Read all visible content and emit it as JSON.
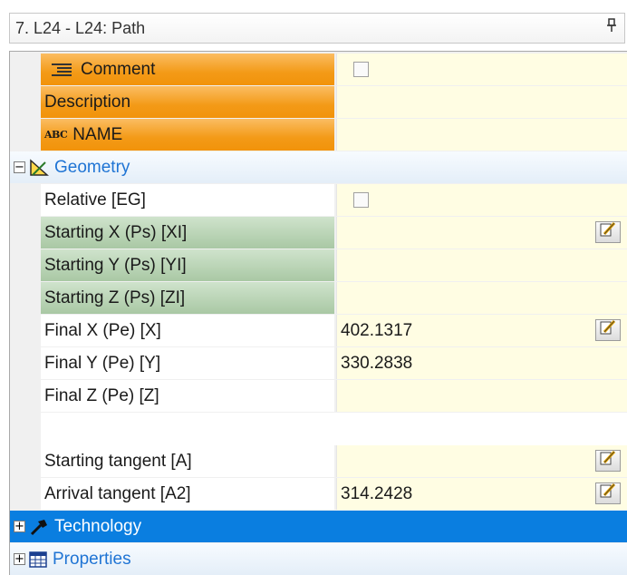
{
  "panel": {
    "title": "7. L24 - L24: Path",
    "pin_glyph": "q"
  },
  "rows": {
    "comment": {
      "label": "Comment"
    },
    "description": {
      "label": "Description"
    },
    "name": {
      "label": "NAME",
      "icon_text": "ABC"
    },
    "relative": {
      "label": "Relative [EG]"
    },
    "start_x": {
      "label": "Starting X (Ps) [XI]",
      "value": ""
    },
    "start_y": {
      "label": "Starting Y (Ps) [YI]",
      "value": ""
    },
    "start_z": {
      "label": "Starting Z (Ps) [ZI]",
      "value": ""
    },
    "final_x": {
      "label": "Final X (Pe) [X]",
      "value": "402.1317"
    },
    "final_y": {
      "label": "Final Y (Pe) [Y]",
      "value": "330.2838"
    },
    "final_z": {
      "label": "Final Z (Pe) [Z]",
      "value": ""
    },
    "start_tan": {
      "label": "Starting tangent [A]",
      "value": ""
    },
    "arrival_tan": {
      "label": "Arrival tangent [A2]",
      "value": "314.2428"
    }
  },
  "groups": {
    "geometry": {
      "label": "Geometry",
      "toggle": "−"
    },
    "technology": {
      "label": "Technology",
      "toggle": "+"
    },
    "properties": {
      "label": "Properties",
      "toggle": "+"
    }
  },
  "icons": [
    "comment-icon",
    "abc-icon",
    "geometry-icon",
    "technology-icon",
    "properties-icon",
    "edit-icon"
  ],
  "colors": {
    "orange": "#f39a17",
    "green": "#a9c8a4",
    "value_bg": "#fffde3",
    "selected": "#0a7ee0",
    "group_text": "#1f74d4"
  }
}
